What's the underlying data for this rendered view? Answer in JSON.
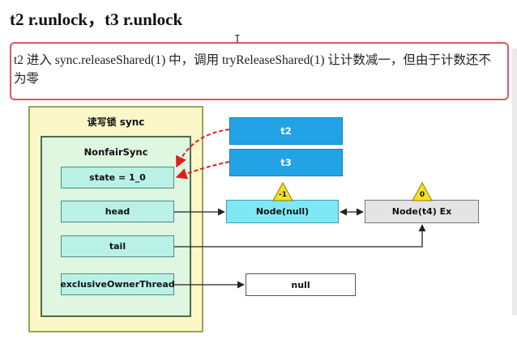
{
  "heading": "t2 r.unlock，t3 r.unlock",
  "note": "t2 进入 sync.releaseShared(1) 中，调用 tryReleaseShared(1) 让计数减一，但由于计数还不为零",
  "cursor_glyph": "I",
  "diagram": {
    "sync_label": "读写锁 sync",
    "nonfair_label": "NonfairSync",
    "fields": {
      "state": "state = 1_0",
      "head": "head",
      "tail": "tail",
      "owner": "exclusiveOwnerThread"
    },
    "threads": {
      "t2": "t2",
      "t3": "t3"
    },
    "nodes": {
      "node_null": {
        "label": "Node(null)",
        "badge": "-1"
      },
      "node_t4": {
        "label": "Node(t4) Ex",
        "badge": "0"
      }
    },
    "null_label": "null",
    "colors": {
      "sync_fill": "#fbf7c8",
      "nonfair_fill": "#dff6e0",
      "field_fill": "#b9f1e6",
      "thread_fill": "#22a3e6",
      "node_null_fill": "#7fe8f5",
      "node_t4_fill": "#e4e4e4",
      "badge_fill": "#f6e21c",
      "dashed_arrow": "#e02020",
      "note_border": "#e05465"
    }
  }
}
